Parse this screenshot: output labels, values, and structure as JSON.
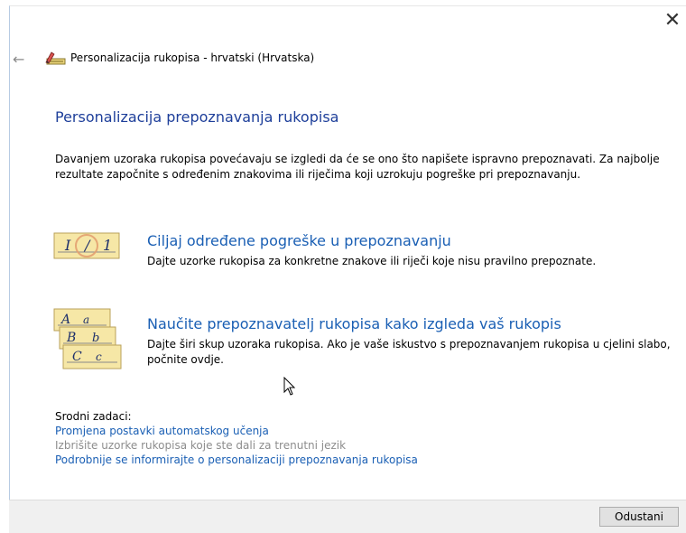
{
  "window": {
    "title": "Personalizacija rukopisa - hrvatski (Hrvatska)",
    "close_symbol": "✕"
  },
  "nav": {
    "back_symbol": "←"
  },
  "main": {
    "heading": "Personalizacija prepoznavanja rukopisa",
    "intro": "Davanjem uzoraka rukopisa povećavaju se izgledi da će se ono što napišete ispravno prepoznavati. Za najbolje rezultate započnite s određenim znakovima ili riječima koji uzrokuju pogreške pri prepoznavanju.",
    "options": [
      {
        "title": "Ciljaj određene pogreške u prepoznavanju",
        "description": "Dajte uzorke rukopisa za konkretne znakove ili riječi koje nisu pravilno prepoznate.",
        "icon": "target-errors-icon"
      },
      {
        "title": "Naučite prepoznavatelj rukopisa kako izgleda vaš rukopis",
        "description": "Dajte širi skup uzoraka rukopisa. Ako je vaše iskustvo s prepoznavanjem rukopisa u cjelini slabo, počnite ovdje.",
        "icon": "handwriting-samples-icon"
      }
    ]
  },
  "related": {
    "label": "Srodni zadaci:",
    "links": [
      "Promjena postavki automatskog učenja",
      "Izbrišite uzorke rukopisa koje ste dali za trenutni jezik",
      "Podrobnije se informirajte o personalizaciji prepoznavanja rukopisa"
    ]
  },
  "footer": {
    "cancel_label": "Odustani"
  },
  "colors": {
    "heading": "#1e3f9a",
    "link": "#1a5fb4",
    "disabled_link": "#8d8d8d",
    "footer_bg": "#f0f0f0"
  }
}
